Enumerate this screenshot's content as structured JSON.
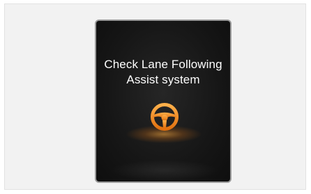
{
  "cluster": {
    "message_line1": "Check Lane Following",
    "message_line2": "Assist system",
    "icon": "steering-wheel-icon",
    "icon_color": "#f08a1e",
    "background_color": "#161616",
    "text_color": "#ffffff"
  }
}
